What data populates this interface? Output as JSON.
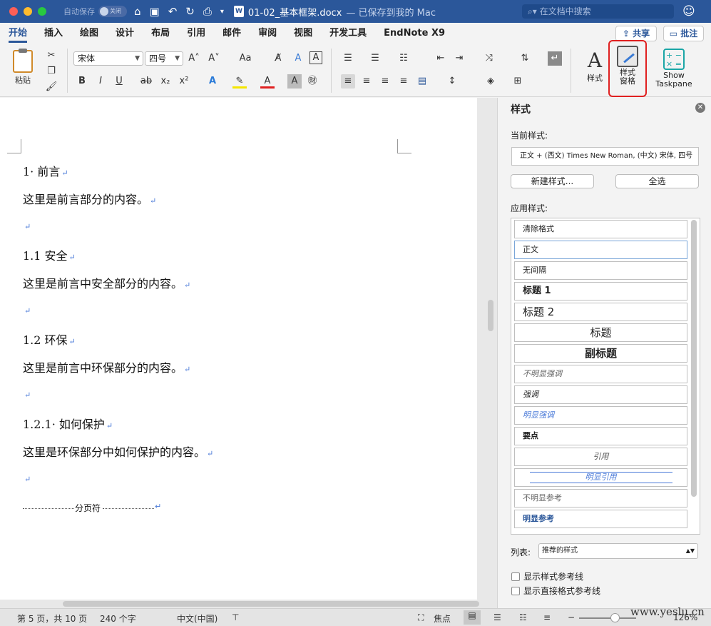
{
  "titlebar": {
    "autosave_label": "自动保存",
    "autosave_state": "关闭",
    "doc_icon_letter": "W",
    "filename": "01-02_基本框架.docx",
    "saved_status": "— 已保存到我的 Mac",
    "search_placeholder": "在文档中搜索"
  },
  "tabs": [
    "开始",
    "插入",
    "绘图",
    "设计",
    "布局",
    "引用",
    "邮件",
    "审阅",
    "视图",
    "开发工具",
    "EndNote X9"
  ],
  "share_label": "共享",
  "comment_label": "批注",
  "ribbon": {
    "paste_label": "粘贴",
    "font_name": "宋体",
    "font_size": "四号",
    "styles_label": "样式",
    "styles_pane_label_1": "样式",
    "styles_pane_label_2": "窗格",
    "show_taskpane_1": "Show",
    "show_taskpane_2": "Taskpane",
    "bold": "B",
    "italic": "I",
    "underline": "U",
    "strike": "ab",
    "subscript": "x₂",
    "superscript": "x²",
    "grow_font": "A˄",
    "shrink_font": "A˅",
    "change_case": "Aa",
    "text_effects": "A",
    "font_color": "A"
  },
  "document": {
    "paragraphs": [
      {
        "text": "1· 前言"
      },
      {
        "text": "这里是前言部分的内容。"
      },
      {
        "text": ""
      },
      {
        "text": "1.1 安全"
      },
      {
        "text": "这里是前言中安全部分的内容。"
      },
      {
        "text": ""
      },
      {
        "text": "1.2 环保"
      },
      {
        "text": "这里是前言中环保部分的内容。"
      },
      {
        "text": ""
      },
      {
        "text": "1.2.1· 如何保护"
      },
      {
        "text": "这里是环保部分中如何保护的内容。"
      },
      {
        "text": ""
      }
    ],
    "page_break_label": "分页符",
    "para_mark": "↵"
  },
  "styles_pane": {
    "title": "样式",
    "current_style_label": "当前样式:",
    "current_style_value": "正文 + (西文) Times New Roman, (中文) 宋体, 四号",
    "new_style_button": "新建样式...",
    "select_all_button": "全选",
    "apply_style_label": "应用样式:",
    "styles": [
      {
        "name": "清除格式"
      },
      {
        "name": "正文"
      },
      {
        "name": "无间隔"
      },
      {
        "name": "标题 1"
      },
      {
        "name": "标题 2"
      },
      {
        "name": "标题"
      },
      {
        "name": "副标题"
      },
      {
        "name": "不明显强调"
      },
      {
        "name": "强调"
      },
      {
        "name": "明显强调"
      },
      {
        "name": "要点"
      },
      {
        "name": "引用"
      },
      {
        "name": "明显引用"
      },
      {
        "name": "不明显参考"
      },
      {
        "name": "明显参考"
      }
    ],
    "list_label": "列表:",
    "list_value": "推荐的样式",
    "show_style_guides": "显示样式参考线",
    "show_direct_format_guides": "显示直接格式参考线"
  },
  "statusbar": {
    "page_info": "第 5 页，共 10 页",
    "word_count": "240 个字",
    "language": "中文(中国)",
    "focus_label": "焦点",
    "zoom": "126%"
  },
  "watermark": "www.yeslu.cn",
  "colors": {
    "titlebar": "#2b579a",
    "accent": "#2b579a",
    "highlight_border": "#e02020"
  }
}
